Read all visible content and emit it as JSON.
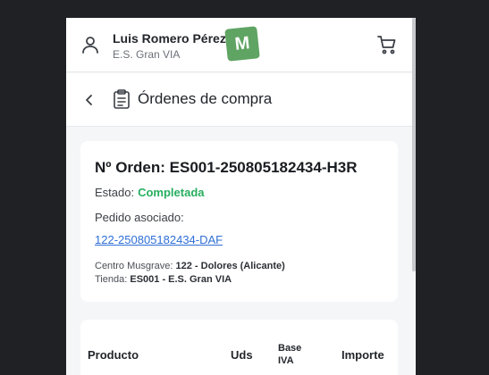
{
  "header": {
    "user_name": "Luis Romero Pérez",
    "store": "E.S. Gran VIA",
    "logo_letter": "M",
    "logo_color": "#5fa463"
  },
  "subheader": {
    "title": "Órdenes de compra"
  },
  "order": {
    "title": "Nº Orden: ES001-250805182434-H3R",
    "estado_label": "Estado:",
    "estado_value": "Completada",
    "estado_color": "#27ae60",
    "pedido_label": "Pedido asociado:",
    "pedido_link": "122-250805182434-DAF",
    "centro_label": "Centro Musgrave:",
    "centro_value": "122 - Dolores (Alicante)",
    "tienda_label": "Tienda:",
    "tienda_value": "ES001 - E.S. Gran VIA"
  },
  "table": {
    "columns": [
      "Producto",
      "Uds",
      "Base IVA",
      "Importe"
    ]
  },
  "icons": {
    "user": "user-icon",
    "cart": "cart-icon",
    "back": "chevron-left-icon",
    "clipboard": "clipboard-icon"
  }
}
